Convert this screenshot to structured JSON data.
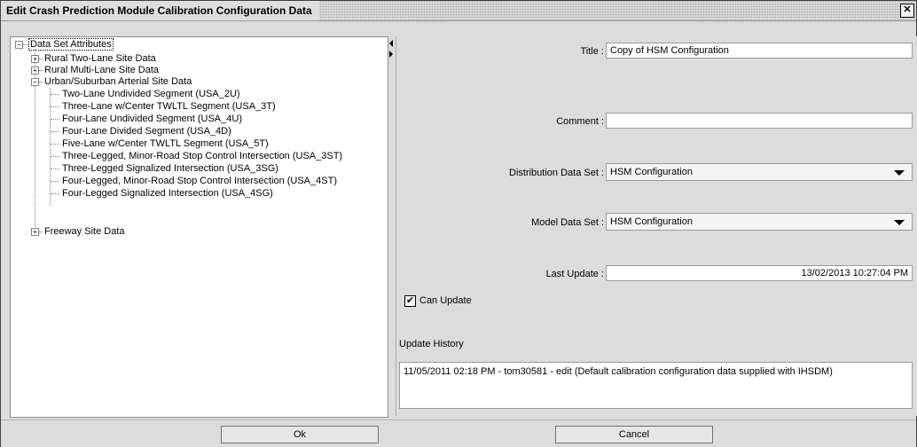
{
  "window": {
    "title": "Edit Crash Prediction Module Calibration Configuration Data",
    "close_glyph": "✕"
  },
  "tree": {
    "root": "Data Set Attributes",
    "groups": [
      {
        "label": "Rural Two-Lane Site Data",
        "expanded": false
      },
      {
        "label": "Rural Multi-Lane Site Data",
        "expanded": false
      },
      {
        "label": "Urban/Suburban Arterial Site Data",
        "expanded": true
      },
      {
        "label": "Freeway Site Data",
        "expanded": false
      }
    ],
    "urban_children": [
      "Two-Lane Undivided Segment (USA_2U)",
      "Three-Lane w/Center TWLTL Segment (USA_3T)",
      "Four-Lane Undivided Segment (USA_4U)",
      "Four-Lane Divided Segment (USA_4D)",
      "Five-Lane w/Center TWLTL Segment (USA_5T)",
      "Three-Legged, Minor-Road Stop Control Intersection (USA_3ST)",
      "Three-Legged Signalized Intersection (USA_3SG)",
      "Four-Legged, Minor-Road Stop Control Intersection (USA_4ST)",
      "Four-Legged Signalized Intersection (USA_4SG)"
    ],
    "expand_glyph": "+",
    "collapse_glyph": "−"
  },
  "form": {
    "title_label": "Title :",
    "title_value": "Copy of HSM Configuration",
    "comment_label": "Comment :",
    "comment_value": "",
    "distribution_label": "Distribution Data Set :",
    "distribution_value": "HSM Configuration",
    "model_label": "Model Data Set :",
    "model_value": "HSM Configuration",
    "last_update_label": "Last Update :",
    "last_update_value": "13/02/2013 10:27:04 PM",
    "can_update_label": "Can Update",
    "can_update_checked": true,
    "check_glyph": "✔",
    "history_label": "Update History",
    "history_entry": "11/05/2011 02:18 PM - tom30581 - edit (Default calibration configuration data supplied with IHSDM)"
  },
  "buttons": {
    "ok_label": "Ok",
    "cancel_label": "Cancel"
  }
}
